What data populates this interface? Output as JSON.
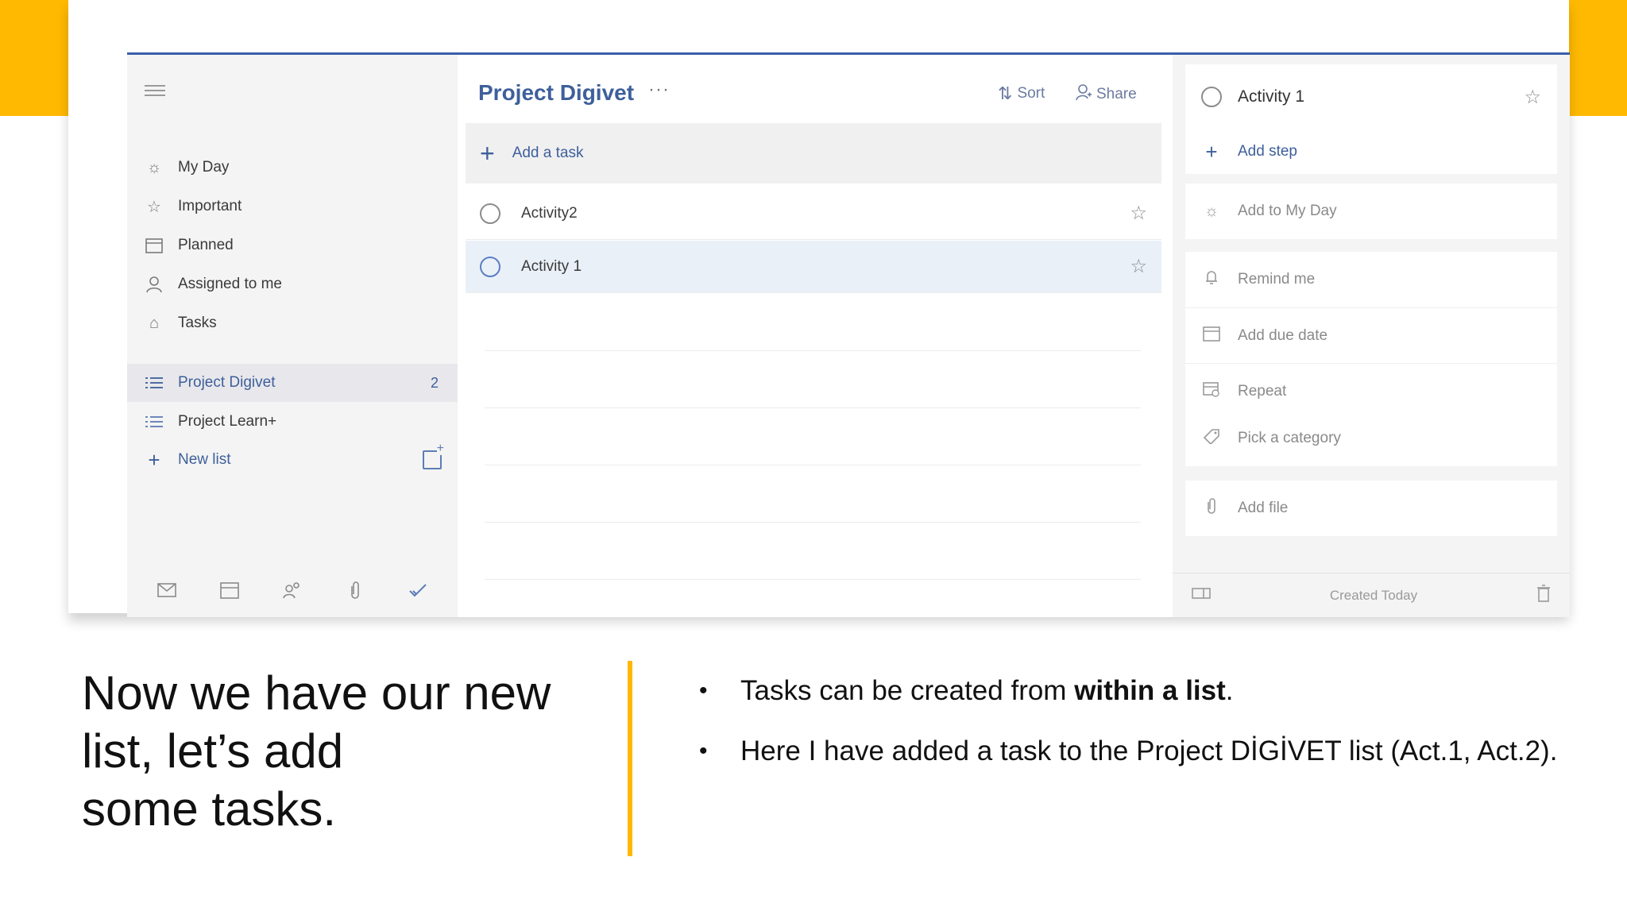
{
  "colors": {
    "accent_yellow": "#FFB900",
    "app_blue": "#3e5f9b"
  },
  "sidebar": {
    "items": [
      {
        "label": "My Day",
        "icon": "sun-icon"
      },
      {
        "label": "Important",
        "icon": "star-icon"
      },
      {
        "label": "Planned",
        "icon": "calendar-icon"
      },
      {
        "label": "Assigned to me",
        "icon": "person-icon"
      },
      {
        "label": "Tasks",
        "icon": "home-icon"
      }
    ],
    "lists": [
      {
        "label": "Project Digivet",
        "count": "2",
        "icon": "list-icon"
      },
      {
        "label": "Project Learn+",
        "icon": "list-icon"
      }
    ],
    "new_list_label": "New list",
    "footer_icons": [
      "mail-icon",
      "calendar-icon",
      "people-icon",
      "attachment-icon",
      "checkmark-icon"
    ]
  },
  "list": {
    "title": "Project Digivet",
    "more": "···",
    "sort_label": "Sort",
    "share_label": "Share",
    "add_task_label": "Add a task",
    "tasks": [
      {
        "label": "Activity2"
      },
      {
        "label": "Activity 1"
      }
    ]
  },
  "detail": {
    "title": "Activity 1",
    "add_step": "Add step",
    "add_to_my_day": "Add to My Day",
    "remind_me": "Remind me",
    "add_due_date": "Add due date",
    "repeat": "Repeat",
    "pick_category": "Pick a category",
    "add_file": "Add file",
    "created": "Created Today"
  },
  "slide": {
    "headline_line1": "Now we have our new",
    "headline_line2": "list, let’s add",
    "headline_line3": "some tasks.",
    "bullet1_prefix": "Tasks can be created from ",
    "bullet1_bold": "within a list",
    "bullet1_suffix": ".",
    "bullet2": "Here I have added a task to the Project DİGİVET list (Act.1, Act.2)."
  }
}
